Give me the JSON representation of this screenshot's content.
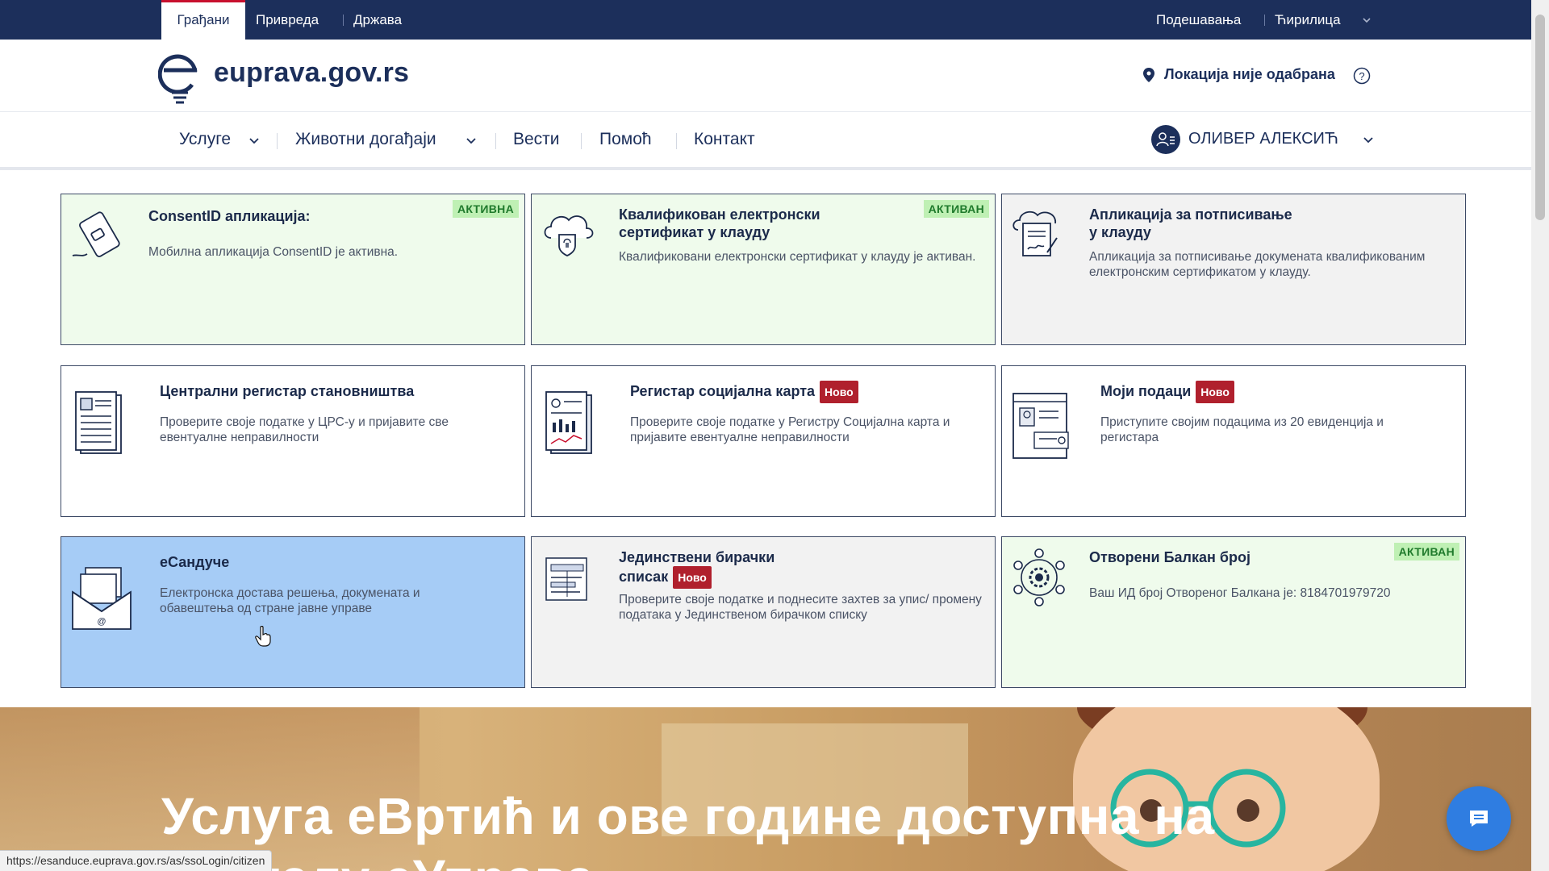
{
  "topbar": {
    "tabs": [
      "Грађани",
      "Привреда",
      "Држава"
    ],
    "active_tab": "Грађани",
    "settings_label": "Подешавања",
    "language_label": "Ћирилица"
  },
  "header": {
    "logo_text": "euprava.gov.rs",
    "location_label": "Локација није одабрана"
  },
  "nav": {
    "items": [
      "Услуге",
      "Животни догађаји",
      "Вести",
      "Помоћ",
      "Контакт"
    ],
    "user_name": "ОЛИВЕР АЛЕКСИЋ"
  },
  "cards": [
    {
      "title": "ConsentID апликација:",
      "desc": "Мобилна апликација ConsentID је активна.",
      "badge": "АКТИВНА",
      "icon": "phone-icon",
      "style": "green"
    },
    {
      "title_line1": "Квалификован електронски",
      "title_line2": "сертификат у клауду",
      "desc": "Квалификовани електронски сертификат у клауду је активан.",
      "badge": "АКТИВАН",
      "icon": "cloud-fingerprint-icon",
      "style": "green"
    },
    {
      "title_line1": "Апликација за потписивање",
      "title_line2": "у клауду",
      "desc": "Апликација за потписивање докумената квалификованим електронским сертификатом у клауду.",
      "icon": "signature-document-icon",
      "style": "gray"
    },
    {
      "title": "Централни регистар становништва",
      "desc": "Проверите своје податке у ЦРС-у и пријавите све евентуалне неправилности",
      "icon": "registry-document-icon",
      "style": "white"
    },
    {
      "title": "Регистар социјална карта",
      "new_badge": "Ново",
      "desc": "Проверите своје податке у Регистру Социјална карта и пријавите евентуалне неправилности",
      "icon": "clipboard-chart-icon",
      "style": "white"
    },
    {
      "title": "Моји подаци",
      "new_badge": "Ново",
      "desc": "Приступите својим подацима из 20 евиденција и регистара",
      "icon": "profile-card-icon",
      "style": "white"
    },
    {
      "title": "еСандуче",
      "desc": "Електронска достава решења, докумената и обавештења од стране јавне управе",
      "icon": "mailbox-icon",
      "style": "blue"
    },
    {
      "title_line1": "Јединствени бирачки",
      "title_line2": "списак",
      "new_badge": "Ново",
      "desc": "Проверите своје податке и поднесите захтев за упис/ промену података у Јединственом бирачком списку",
      "icon": "voter-list-icon",
      "style": "gray"
    },
    {
      "title": "Отворени Балкан број",
      "desc": "Ваш ИД број Отвореног Балкана је: 8184701979720",
      "badge": "АКТИВАН",
      "icon": "network-gear-icon",
      "style": "green"
    }
  ],
  "banner": {
    "headline": "Услуга еВртић и ове године доступна на",
    "headline2": "порталу еУправа"
  },
  "status_url": "https://esanduce.euprava.gov.rs/as/ssoLogin/citizen",
  "colors": {
    "primary": "#1c2f5b",
    "accent_red": "#b0202d",
    "active_green": "#bff0b4",
    "hover_blue": "#a6ccf6"
  }
}
